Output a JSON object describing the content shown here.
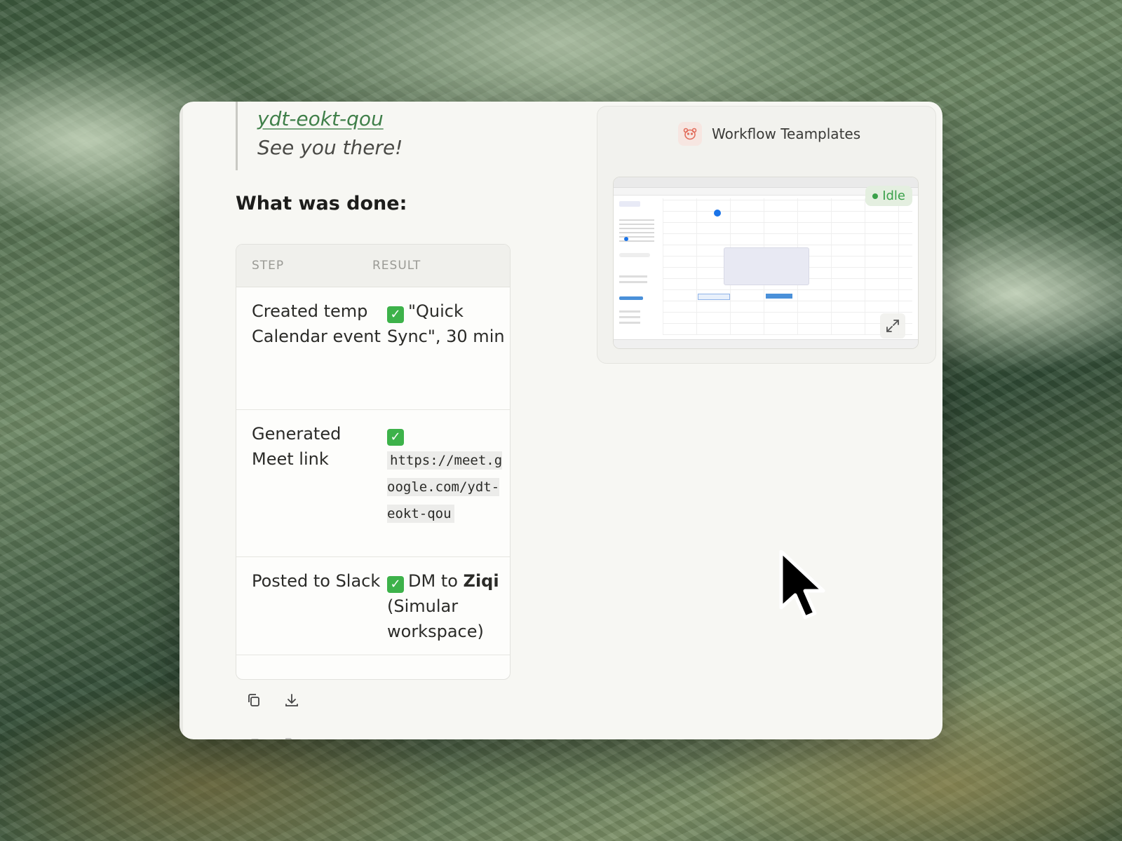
{
  "message": {
    "quote_link": "ydt-eokt-qou",
    "quote_text": "See you there!",
    "section_title": "What was done:",
    "table": {
      "headers": [
        "STEP",
        "RESULT"
      ],
      "rows": [
        {
          "step": "Created temp Calendar event",
          "result_text": "\"Quick Sync\", 30 min"
        },
        {
          "step": "Generated Meet link",
          "result_code": "https://meet.google.com/ydt-eokt-qou"
        },
        {
          "step": "Posted to Slack",
          "result_prefix": "DM to ",
          "result_bold": "Ziqi",
          "result_suffix": " (Simular workspace)"
        }
      ]
    },
    "actions": [
      "copy-icon",
      "download-icon"
    ]
  },
  "panel": {
    "title": "Workflow Teamplates",
    "status": "Idle",
    "status_color": "#3aa14a",
    "preview_icons": [
      "expand-icon"
    ]
  },
  "colors": {
    "check": "#3db24a",
    "link": "#3f7f49"
  }
}
